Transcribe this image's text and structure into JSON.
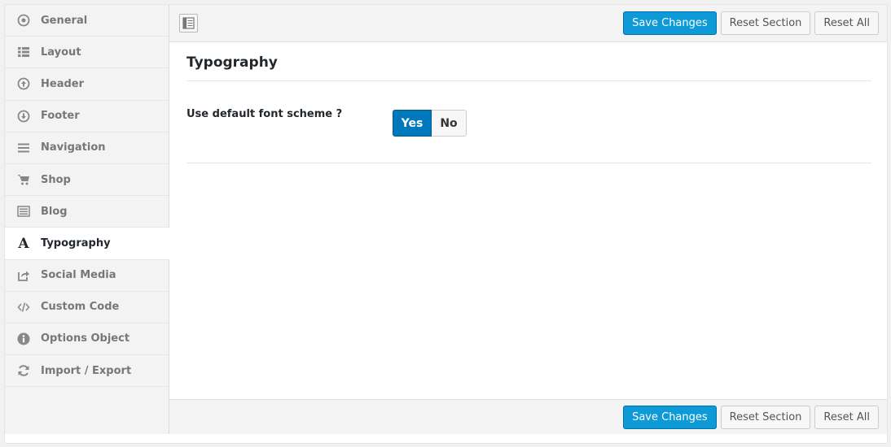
{
  "sidebar": {
    "items": [
      {
        "label": "General",
        "icon": "target-icon"
      },
      {
        "label": "Layout",
        "icon": "list-icon"
      },
      {
        "label": "Header",
        "icon": "arrow-up-circle-icon"
      },
      {
        "label": "Footer",
        "icon": "arrow-down-circle-icon"
      },
      {
        "label": "Navigation",
        "icon": "menu-icon"
      },
      {
        "label": "Shop",
        "icon": "cart-icon"
      },
      {
        "label": "Blog",
        "icon": "blog-icon"
      },
      {
        "label": "Typography",
        "icon": "typography-icon",
        "active": true
      },
      {
        "label": "Social Media",
        "icon": "share-icon"
      },
      {
        "label": "Custom Code",
        "icon": "code-icon"
      },
      {
        "label": "Options Object",
        "icon": "info-icon"
      },
      {
        "label": "Import / Export",
        "icon": "refresh-icon"
      }
    ]
  },
  "toolbar": {
    "save_label": "Save Changes",
    "reset_section_label": "Reset Section",
    "reset_all_label": "Reset All"
  },
  "section": {
    "title": "Typography",
    "field_label": "Use default font scheme ?",
    "switch_on_label": "Yes",
    "switch_off_label": "No",
    "selected": "Yes"
  },
  "colors": {
    "primary_button": "#0d9ad6",
    "switch_active": "#0079bc",
    "sidebar_bg": "#f3f3f3"
  }
}
